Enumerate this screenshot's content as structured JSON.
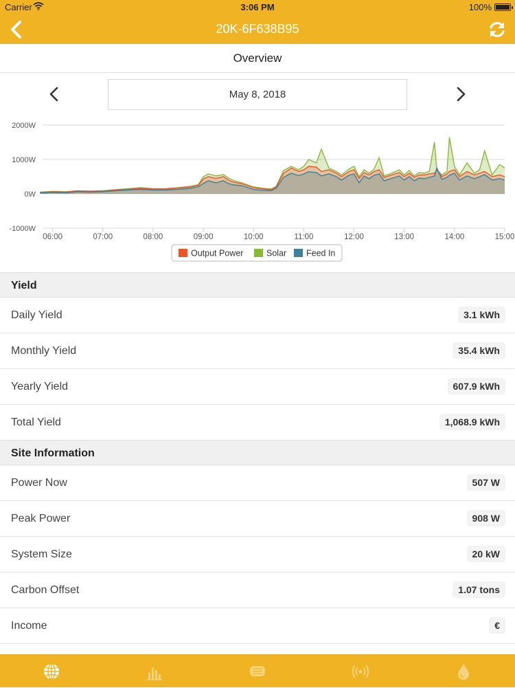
{
  "status_bar": {
    "carrier": "Carrier",
    "time": "3:06 PM",
    "battery": "100%"
  },
  "nav": {
    "title": "20K-6F638B95",
    "back_icon": "chevron-left-icon",
    "refresh_icon": "refresh-icon"
  },
  "subheader": {
    "title": "Overview"
  },
  "date_bar": {
    "date": "May 8, 2018"
  },
  "colors": {
    "accent": "#f0b323",
    "output_power": "#e8562a",
    "solar": "#8cb83a",
    "feed_in": "#3e7f9e"
  },
  "chart_data": {
    "type": "area",
    "y_tick_labels": [
      "2000W",
      "1000W",
      "0W",
      "-1000W"
    ],
    "y_ticks": [
      2000,
      1000,
      0,
      -1000
    ],
    "ylim": [
      -1000,
      2000
    ],
    "x_tick_labels": [
      "06:00",
      "07:00",
      "08:00",
      "09:00",
      "10:00",
      "11:00",
      "12:00",
      "13:00",
      "14:00",
      "15:00"
    ],
    "x_ticks_hours": [
      6,
      7,
      8,
      9,
      10,
      11,
      12,
      13,
      14,
      15
    ],
    "x": [
      5.75,
      6,
      6.25,
      6.5,
      6.75,
      7,
      7.25,
      7.5,
      7.75,
      8,
      8.25,
      8.5,
      8.75,
      8.9,
      9,
      9.1,
      9.25,
      9.4,
      9.5,
      9.6,
      9.75,
      10,
      10.2,
      10.35,
      10.45,
      10.6,
      10.75,
      10.9,
      11,
      11.1,
      11.25,
      11.35,
      11.5,
      11.65,
      11.75,
      11.9,
      12,
      12.1,
      12.2,
      12.3,
      12.4,
      12.5,
      12.6,
      12.75,
      12.9,
      13,
      13.1,
      13.2,
      13.3,
      13.4,
      13.5,
      13.6,
      13.65,
      13.75,
      13.85,
      13.9,
      14,
      14.1,
      14.25,
      14.4,
      14.5,
      14.6,
      14.75,
      14.9,
      15
    ],
    "legend": [
      "Output Power",
      "Solar",
      "Feed In"
    ],
    "legend_position": "bottom",
    "series": [
      {
        "name": "Output Power",
        "color": "#e8562a",
        "values": [
          40,
          60,
          50,
          80,
          70,
          80,
          110,
          130,
          160,
          140,
          140,
          170,
          200,
          250,
          430,
          500,
          450,
          500,
          400,
          340,
          300,
          180,
          140,
          120,
          200,
          600,
          750,
          650,
          700,
          800,
          780,
          650,
          700,
          600,
          500,
          650,
          700,
          450,
          620,
          550,
          650,
          700,
          480,
          550,
          620,
          500,
          600,
          480,
          550,
          550,
          580,
          600,
          700,
          500,
          580,
          650,
          700,
          500,
          650,
          550,
          600,
          650,
          500,
          550,
          500
        ]
      },
      {
        "name": "Solar",
        "color": "#8cb83a",
        "values": [
          50,
          70,
          60,
          90,
          80,
          90,
          120,
          150,
          180,
          150,
          150,
          180,
          220,
          270,
          500,
          580,
          520,
          560,
          460,
          390,
          330,
          200,
          160,
          140,
          220,
          680,
          800,
          700,
          800,
          1000,
          900,
          1300,
          750,
          650,
          550,
          720,
          800,
          500,
          700,
          600,
          720,
          1050,
          520,
          600,
          700,
          550,
          680,
          520,
          620,
          600,
          660,
          1500,
          700,
          550,
          650,
          1650,
          800,
          550,
          900,
          600,
          700,
          1250,
          550,
          850,
          750
        ]
      },
      {
        "name": "Feed In",
        "color": "#3e7f9e",
        "values": [
          20,
          40,
          30,
          60,
          50,
          60,
          90,
          110,
          130,
          110,
          110,
          130,
          160,
          210,
          300,
          380,
          320,
          380,
          300,
          260,
          240,
          130,
          100,
          90,
          160,
          480,
          600,
          530,
          580,
          640,
          620,
          520,
          580,
          500,
          400,
          540,
          580,
          320,
          520,
          440,
          540,
          580,
          380,
          450,
          520,
          400,
          500,
          380,
          460,
          440,
          480,
          520,
          750,
          420,
          480,
          540,
          600,
          400,
          520,
          440,
          500,
          560,
          400,
          440,
          400
        ]
      }
    ]
  },
  "yield": {
    "header": "Yield",
    "rows": [
      {
        "label": "Daily Yield",
        "value": "3.1 kWh"
      },
      {
        "label": "Monthly Yield",
        "value": "35.4 kWh"
      },
      {
        "label": "Yearly Yield",
        "value": "607.9 kWh"
      },
      {
        "label": "Total Yield",
        "value": "1,068.9 kWh"
      }
    ]
  },
  "site": {
    "header": "Site Information",
    "rows": [
      {
        "label": "Power Now",
        "value": "507 W"
      },
      {
        "label": "Peak Power",
        "value": "908 W"
      },
      {
        "label": "System Size",
        "value": "20 kW"
      },
      {
        "label": "Carbon Offset",
        "value": "1.07 tons"
      },
      {
        "label": "Income",
        "value": "€"
      }
    ]
  },
  "tabbar": {
    "tabs": [
      {
        "icon": "globe-icon"
      },
      {
        "icon": "bar-chart-icon"
      },
      {
        "icon": "inverter-icon"
      },
      {
        "icon": "signal-icon"
      },
      {
        "icon": "drop-icon"
      }
    ]
  }
}
